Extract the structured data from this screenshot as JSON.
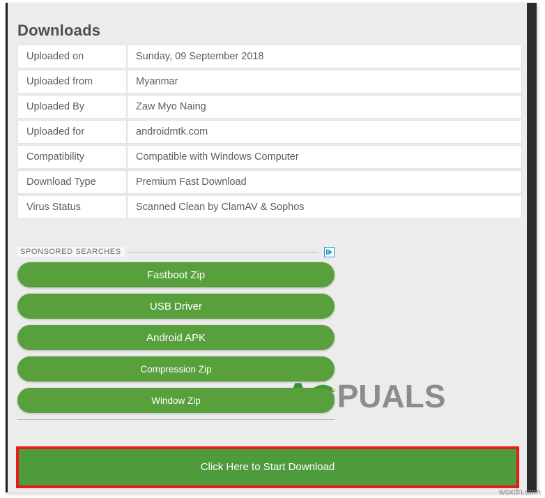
{
  "page": {
    "title": "Downloads",
    "watermark_text": "wsxdn.com",
    "brand_logo_text": "PUALS",
    "brand_logo_initial": "A",
    "accent_green": "#57a03b",
    "highlight_red": "#e81c14",
    "background": "#ececec"
  },
  "info_table": {
    "rows": [
      {
        "label": "Uploaded on",
        "value": "Sunday, 09 September 2018"
      },
      {
        "label": "Uploaded from",
        "value": "Myanmar"
      },
      {
        "label": "Uploaded By",
        "value": "Zaw Myo Naing"
      },
      {
        "label": "Uploaded for",
        "value": "androidmtk.com"
      },
      {
        "label": "Compatibility",
        "value": "Compatible with Windows Computer"
      },
      {
        "label": "Download Type",
        "value": "Premium Fast Download"
      },
      {
        "label": "Virus Status",
        "value": "Scanned Clean by ClamAV & Sophos"
      }
    ]
  },
  "ad": {
    "label": "SPONSORED SEARCHES",
    "adchoices_icon": "adchoices-icon",
    "buttons": [
      {
        "label": "Fastboot Zip"
      },
      {
        "label": "USB Driver"
      },
      {
        "label": "Android APK"
      },
      {
        "label": "Compression Zip"
      },
      {
        "label": "Window Zip"
      }
    ]
  },
  "download": {
    "button_label": "Click Here to Start Download"
  }
}
